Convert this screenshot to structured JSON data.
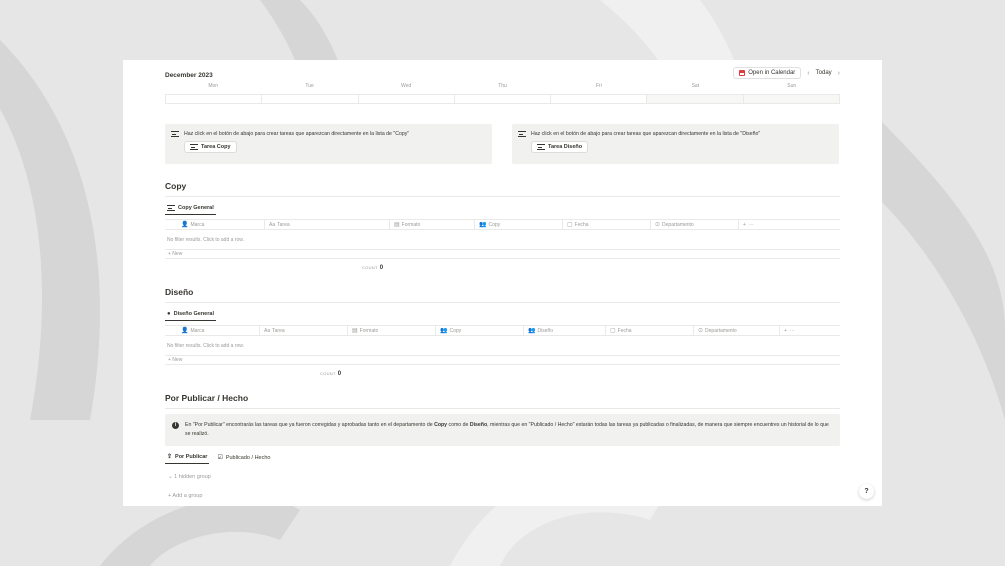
{
  "calendar": {
    "month": "December 2023",
    "open_in_calendar": "Open in Calendar",
    "today": "Today",
    "prev_arrow": "‹",
    "next_arrow": "›",
    "days": [
      "Mon",
      "Tue",
      "Wed",
      "Thu",
      "Fri",
      "Sat",
      "Sun"
    ]
  },
  "callouts": {
    "copy": {
      "text": "Haz click en el botón de abajo para crear tareas que aparezcan directamente en la lista de \"Copy\"",
      "button": "Tarea Copy"
    },
    "diseno": {
      "text": "Haz click en el botón de abajo para crear tareas que aparezcan directamente en la lista de \"Diseño\"",
      "button": "Tarea Diseño"
    }
  },
  "copy_section": {
    "title": "Copy",
    "tab": "Copy General",
    "columns": [
      "Marca",
      "Tarea",
      "Formato",
      "Copy",
      "Fecha",
      "Departamento"
    ],
    "empty": "No filter results. Click to add a row.",
    "new": "+ New",
    "count_label": "COUNT",
    "count_value": "0"
  },
  "diseno_section": {
    "title": "Diseño",
    "tab": "Diseño General",
    "columns": [
      "Marca",
      "Tarea",
      "Formato",
      "Copy",
      "Diseño",
      "Fecha",
      "Departamento"
    ],
    "empty": "No filter results. Click to add a row.",
    "new": "+ New",
    "count_label": "COUNT",
    "count_value": "0"
  },
  "publicar_section": {
    "title": "Por Publicar / Hecho",
    "info_pre": "En \"Por Publicar\" encontrarás las tareas que ya fueron corregidas y aprobadas tanto en el departamento de ",
    "info_copy": "Copy",
    "info_mid": " como de ",
    "info_diseno": "Diseño",
    "info_post": ", mientras que en \"Publicado / Hecho\" estarán todas las tareas ya publicadas o finalizadas, de manera que siempre encuentres un historial de lo que se realizó.",
    "tab_1": "Por Publicar",
    "tab_2": "Publicado / Hecho",
    "hidden_group": "1 hidden group",
    "add_group": "+ Add a group"
  },
  "help": "?",
  "colors": {
    "background": "#e6e6e6",
    "card": "#ffffff",
    "callout": "#f1f1ef",
    "accent_red": "#e03e3e"
  }
}
